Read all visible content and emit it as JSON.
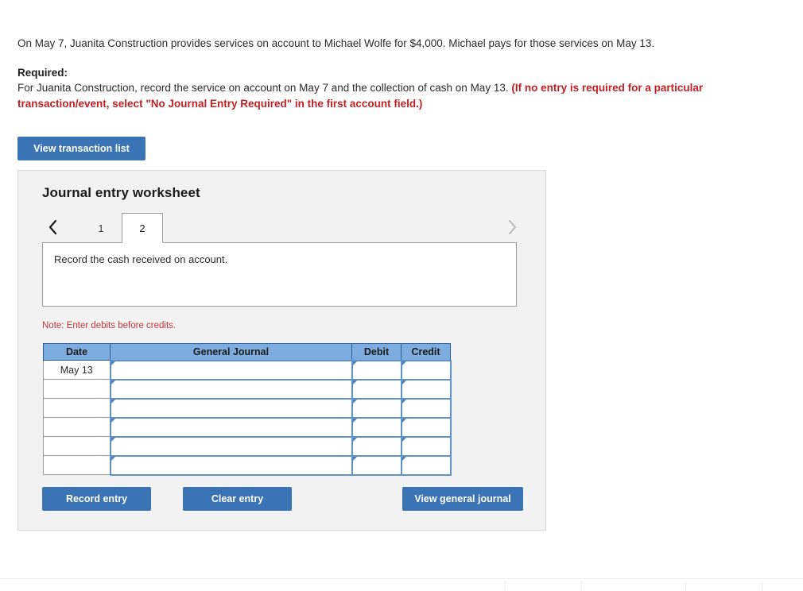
{
  "problem": {
    "scenario": "On May 7, Juanita Construction provides services on account to Michael Wolfe for $4,000. Michael pays for those services on May 13.",
    "required_label": "Required:",
    "required_text_1": "For Juanita Construction, record the service on account on May 7 and the collection of cash on May 13. ",
    "required_text_red": "(If no entry is required for a particular transaction/event, select \"No Journal Entry Required\" in the first account field.)"
  },
  "toolbar": {
    "view_transaction_list": "View transaction list"
  },
  "worksheet": {
    "title": "Journal entry worksheet",
    "tabs": [
      {
        "label": "1",
        "active": false
      },
      {
        "label": "2",
        "active": true
      }
    ],
    "prev_icon": "chevron-left-icon",
    "next_icon": "chevron-right-icon",
    "description": "Record the cash received on account.",
    "note": "Note: Enter debits before credits."
  },
  "journal_table": {
    "headers": [
      "Date",
      "General Journal",
      "Debit",
      "Credit"
    ],
    "rows": [
      {
        "date": "May 13",
        "general_journal": "",
        "debit": "",
        "credit": ""
      },
      {
        "date": "",
        "general_journal": "",
        "debit": "",
        "credit": ""
      },
      {
        "date": "",
        "general_journal": "",
        "debit": "",
        "credit": ""
      },
      {
        "date": "",
        "general_journal": "",
        "debit": "",
        "credit": ""
      },
      {
        "date": "",
        "general_journal": "",
        "debit": "",
        "credit": ""
      },
      {
        "date": "",
        "general_journal": "",
        "debit": "",
        "credit": ""
      }
    ]
  },
  "footer_buttons": {
    "record_entry": "Record entry",
    "clear_entry": "Clear entry",
    "view_general_journal": "View general journal"
  },
  "colors": {
    "accent_blue": "#3a74b4",
    "table_header_blue": "#7cadde",
    "input_border_blue": "#5e92c9",
    "alert_red": "#c32025",
    "note_red": "#c3353a",
    "panel_gray": "#f2f2f2"
  }
}
